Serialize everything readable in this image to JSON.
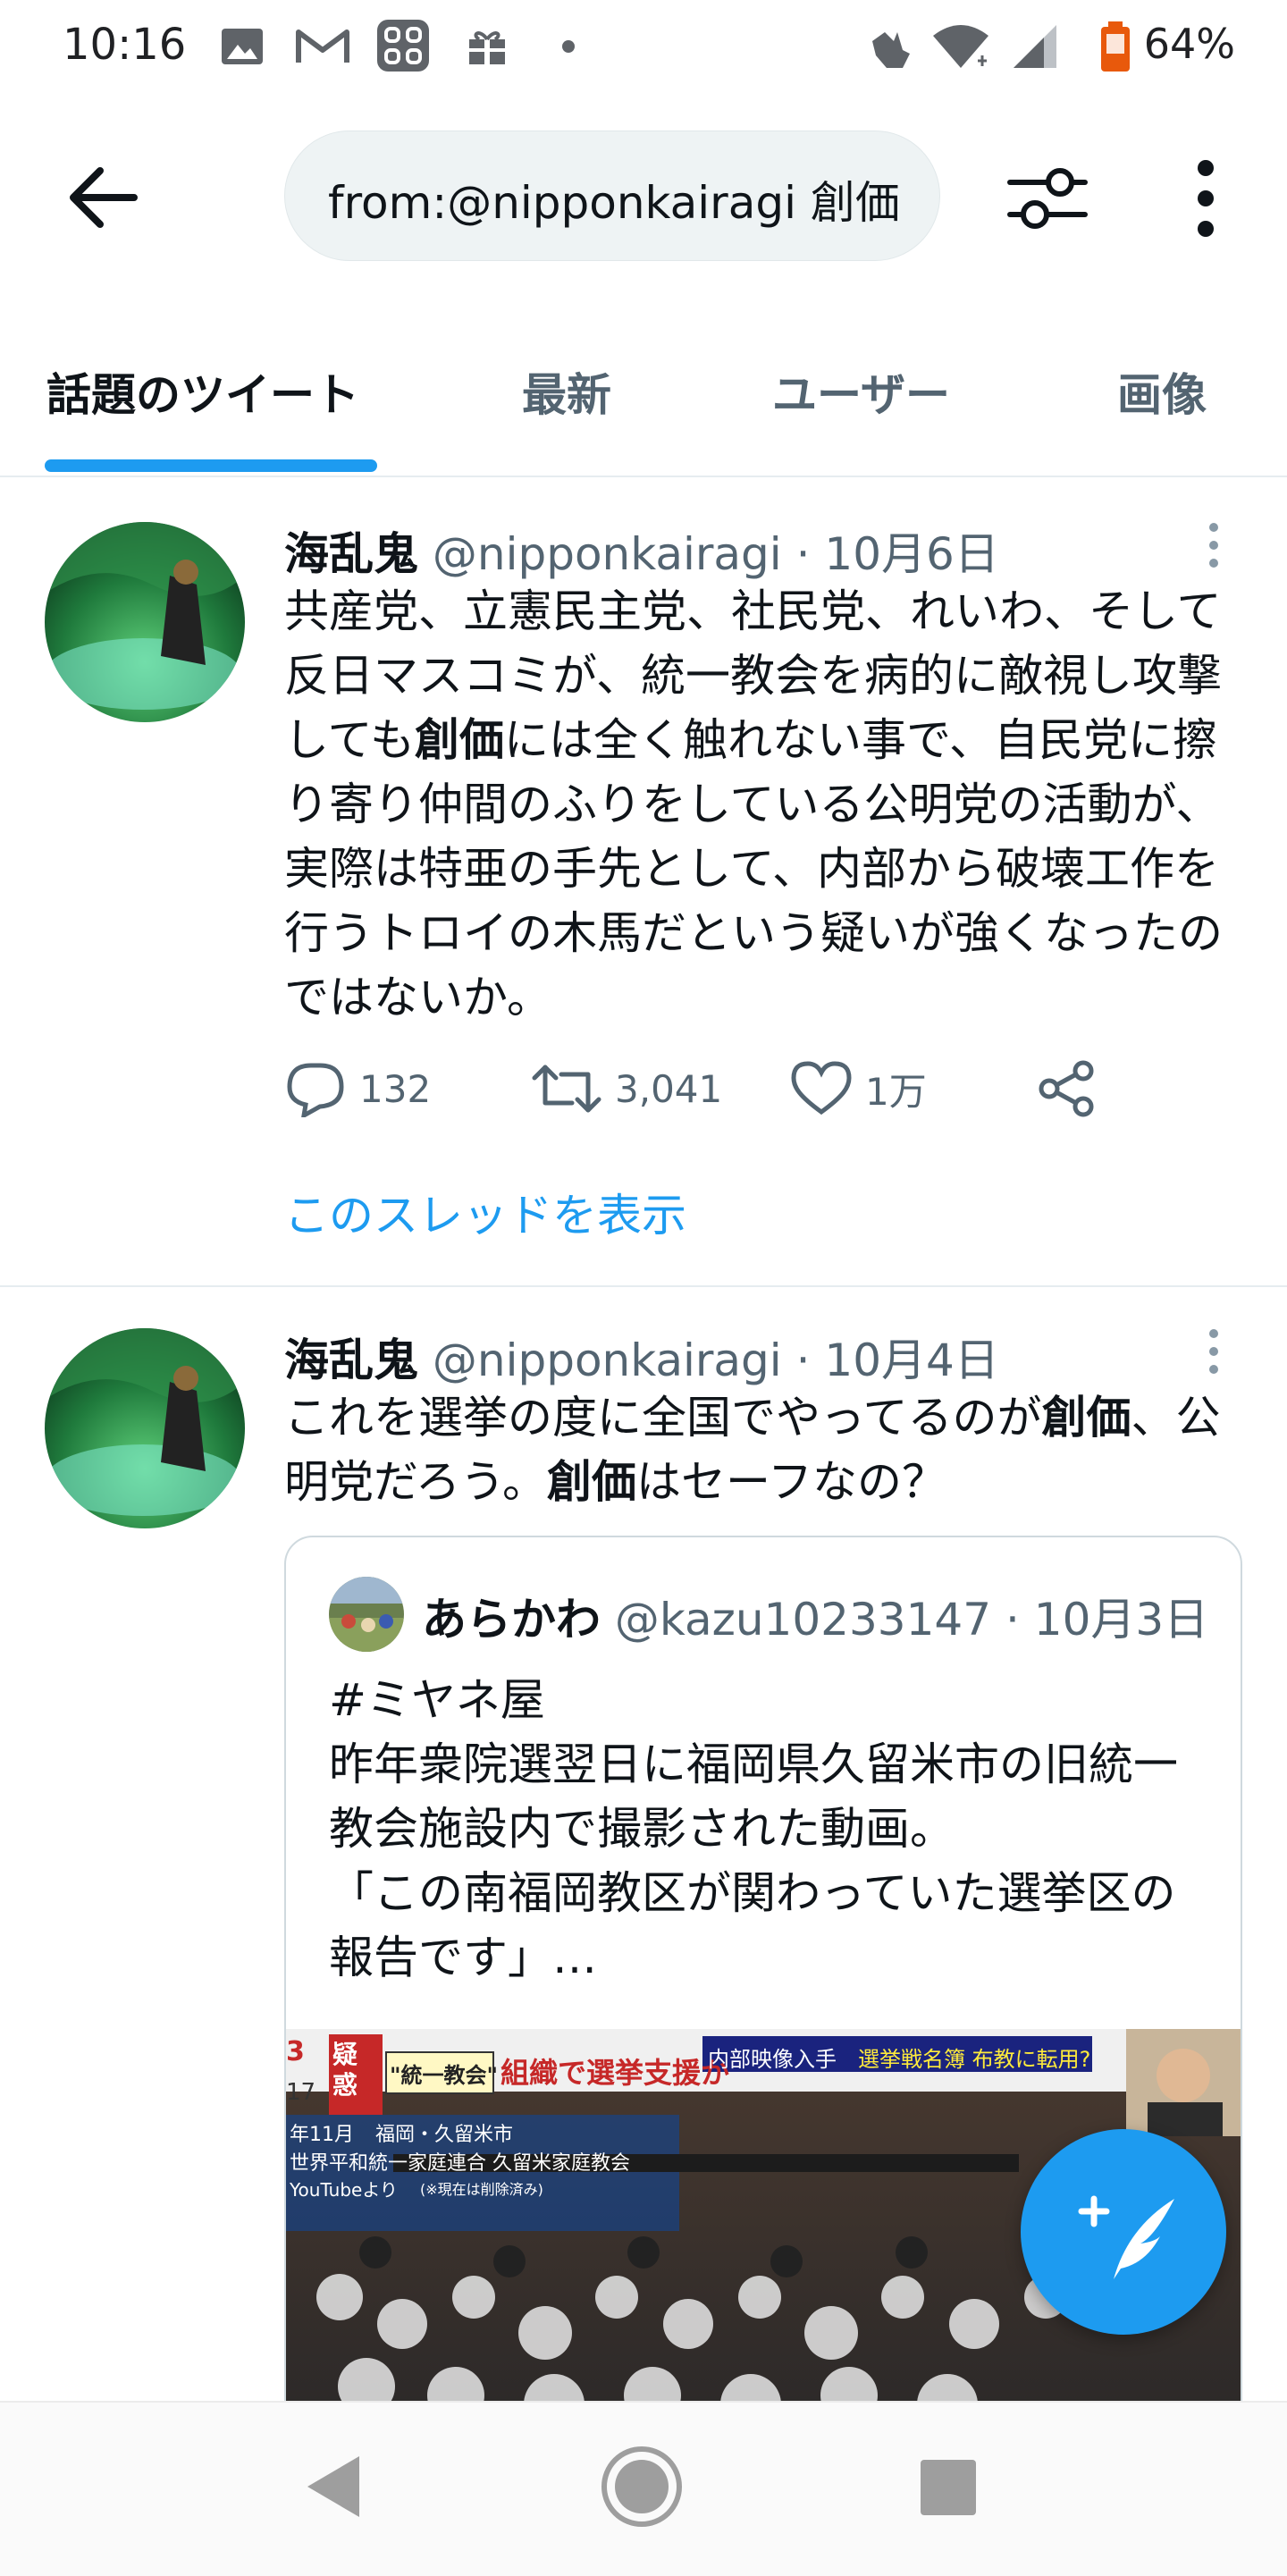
{
  "status_bar": {
    "time": "10:16",
    "battery": "64%",
    "icons": [
      "image-icon",
      "gmail-icon",
      "apps-icon",
      "gift-icon",
      "dot-icon",
      "hand-icon",
      "wifi-icon",
      "signal-icon",
      "battery-icon"
    ]
  },
  "search": {
    "query": "from:@nipponkairagi 創価",
    "back_icon": "arrow-left-icon",
    "filter_icon": "filter-icon",
    "more_icon": "more-vertical-icon"
  },
  "tabs": [
    {
      "label": "話題のツイート",
      "active": true
    },
    {
      "label": "最新",
      "active": false
    },
    {
      "label": "ユーザー",
      "active": false
    },
    {
      "label": "画像",
      "active": false
    }
  ],
  "tweets": [
    {
      "name": "海乱鬼",
      "handle": "@nipponkairagi",
      "sep": "·",
      "date": "10月6日",
      "text_parts": [
        "共産党、立憲民主党、社民党、れいわ、そして反日マスコミが、統一教会を病的に敵視し攻撃しても",
        "創価",
        "には全く触れない事で、自民党に擦り寄り仲間のふりをしている公明党の活動が、実際は特亜の手先として、内部から破壊工作を行うトロイの木馬だという疑いが強くなったのではないか。"
      ],
      "replies": "132",
      "retweets": "3,041",
      "likes": "1万",
      "thread_link": "このスレッドを表示"
    },
    {
      "name": "海乱鬼",
      "handle": "@nipponkairagi",
      "sep": "·",
      "date": "10月4日",
      "text_parts": [
        "これを選挙の度に全国でやってるのが",
        "創価",
        "、公明党だろう。",
        "創価",
        "はセーフなの？"
      ],
      "quote": {
        "name": "あらかわ",
        "handle": "@kazu10233147",
        "sep": "·",
        "date": "10月3日",
        "text": "#ミヤネ屋\n昨年衆院選翌日に福岡県久留米市の旧統一教会施設内で撮影された動画。\n「この南福岡教区が関わっていた選挙区の報告です」…",
        "media": {
          "left_tag": "疑惑",
          "label1": "\"統一教会\"",
          "label2": "組織で選挙支援か",
          "label3": "内部映像入手",
          "label4": "選挙戦名簿 布教に転用?",
          "caption1": "年11月",
          "caption2": "福岡・久留米市",
          "caption3": "世界平和統一家庭連合 久留米家庭教会",
          "caption4": "YouTubeより",
          "caption5": "(※現在は削除済み)",
          "num1": "3",
          "num2": "17"
        }
      }
    }
  ],
  "fab_icon": "compose-tweet-icon",
  "nav": [
    "back-triangle-icon",
    "home-circle-icon",
    "recents-square-icon"
  ]
}
